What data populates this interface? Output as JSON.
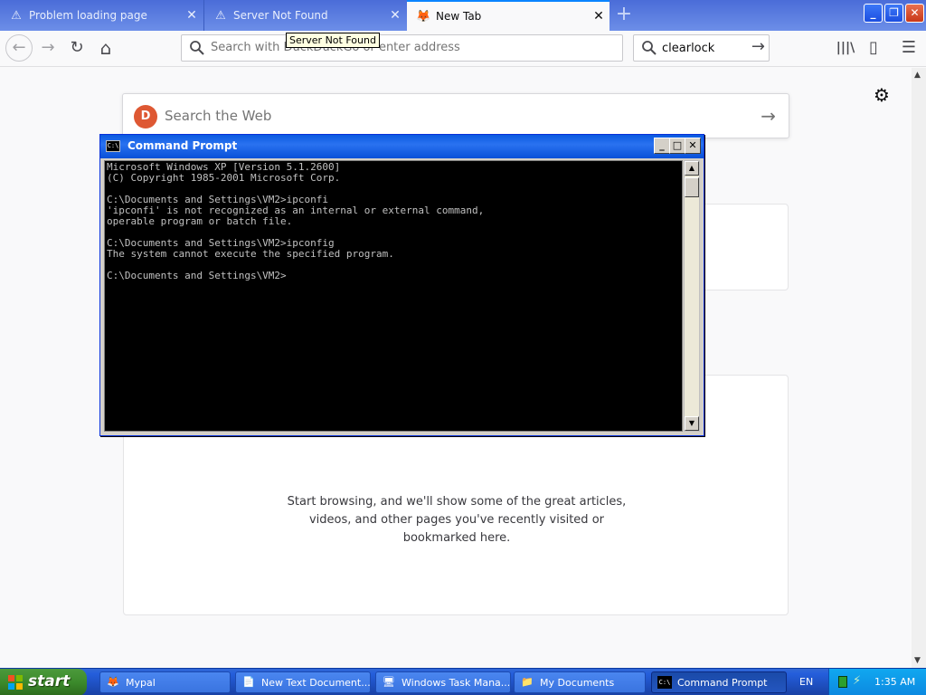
{
  "tabs": [
    {
      "label": "Problem loading page",
      "icon": "warning-icon",
      "close": "✕"
    },
    {
      "label": "Server Not Found",
      "icon": "warning-icon",
      "close": "✕"
    },
    {
      "label": "New Tab",
      "icon": "firefox-icon",
      "close": "✕"
    }
  ],
  "new_tab_symbol": "+",
  "window_buttons": {
    "minimize": "_",
    "restore": "❐",
    "close": "✕"
  },
  "nav": {
    "back": "←",
    "forward": "→",
    "reload": "↻",
    "home": "⌂",
    "url_placeholder": "Search with DuckDuckGo or enter address",
    "search_value": "clearlock",
    "search_go": "→",
    "library": "|||\\",
    "sidebar": "▯",
    "menu": "☰"
  },
  "tooltip": "Server Not Found",
  "newtab": {
    "search_placeholder": "Search the Web",
    "search_go": "→",
    "settings": "⚙",
    "empty_lines": [
      "Start browsing, and we'll show some of the great articles,",
      "videos, and other pages you've recently visited or",
      "bookmarked here."
    ]
  },
  "cmd": {
    "title": "Command Prompt",
    "icon_text": "C:\\",
    "buttons": {
      "minimize": "_",
      "maximize": "□",
      "close": "✕"
    },
    "output": "Microsoft Windows XP [Version 5.1.2600]\n(C) Copyright 1985-2001 Microsoft Corp.\n\nC:\\Documents and Settings\\VM2>ipconfi\n'ipconfi' is not recognized as an internal or external command,\noperable program or batch file.\n\nC:\\Documents and Settings\\VM2>ipconfig\nThe system cannot execute the specified program.\n\nC:\\Documents and Settings\\VM2>"
  },
  "taskbar": {
    "start": "start",
    "tasks": [
      {
        "label": "Mypal",
        "icon": "browser-icon"
      },
      {
        "label": "New Text Document....",
        "icon": "notepad-icon"
      },
      {
        "label": "Windows Task Mana...",
        "icon": "task-manager-icon"
      },
      {
        "label": "My Documents",
        "icon": "folder-icon"
      },
      {
        "label": "Command Prompt",
        "icon": "cmd-icon"
      }
    ],
    "language": "EN",
    "clock": "1:35 AM"
  }
}
